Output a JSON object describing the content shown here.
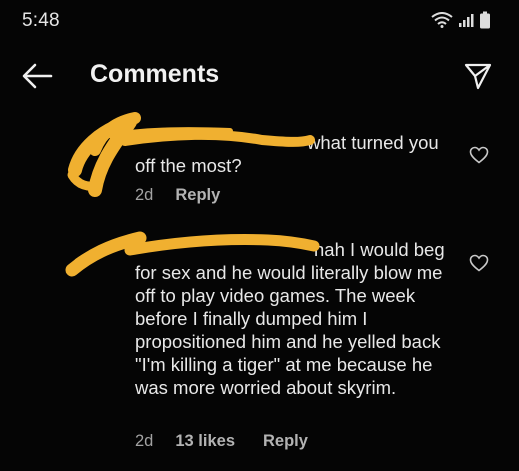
{
  "status_bar": {
    "time": "5:48",
    "wifi_icon": "wifi-icon",
    "signal_icon": "signal-icon",
    "battery_icon": "battery-icon"
  },
  "header": {
    "title": "Comments",
    "back_icon": "back-arrow-icon",
    "send_icon": "send-icon"
  },
  "comments": [
    {
      "text": "what turned you off the most?",
      "age": "2d",
      "reply": "Reply",
      "like_icon": "heart-icon"
    },
    {
      "text": "nah I would beg for sex and he would literally blow me off to play video games. The week before I finally dumped him I propositioned him and he yelled back \"I'm killing a tiger\" at me because he was more worried about skyrim.",
      "age": "2d",
      "likes": "13 likes",
      "reply": "Reply",
      "like_icon": "heart-icon"
    }
  ],
  "colors": {
    "background": "#050505",
    "text": "#e8e8e8",
    "meta": "#a2a2a2",
    "redaction": "#f0b030"
  }
}
